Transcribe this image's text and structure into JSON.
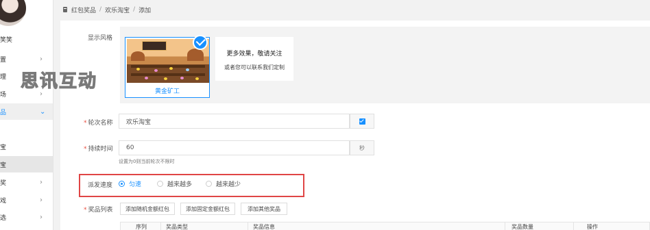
{
  "sidebar": {
    "username": "笑笑",
    "items": [
      {
        "label": "置",
        "chevron": "›"
      },
      {
        "label": "理",
        "chevron": ""
      },
      {
        "label": "场",
        "chevron": "›"
      },
      {
        "label": "品",
        "chevron": "⌄"
      },
      {
        "label": "宝",
        "chevron": ""
      },
      {
        "label": "宝",
        "chevron": ""
      },
      {
        "label": "奖",
        "chevron": "›"
      },
      {
        "label": "戏",
        "chevron": "›"
      },
      {
        "label": "选",
        "chevron": "›"
      }
    ]
  },
  "breadcrumb": [
    "红包奖品",
    "欢乐淘宝",
    "添加"
  ],
  "breadcrumb_separator": "/",
  "watermark": "思讯互动",
  "form": {
    "style_label": "显示风格",
    "theme_name": "黄金矿工",
    "more_title": "更多效果，敬请关注",
    "more_subtitle": "或者您可以联系我们定制",
    "round_name_label": "轮次名称",
    "round_name_value": "欢乐淘宝",
    "duration_label": "持续时间",
    "duration_value": "60",
    "duration_unit": "秒",
    "duration_hint": "设置为0则当前轮次不限时",
    "speed_label": "派发速度",
    "speed_options": [
      "匀速",
      "越来越多",
      "越来越少"
    ],
    "speed_selected": "匀速",
    "prize_label": "奖品列表",
    "prize_buttons": [
      "添加随机金额红包",
      "添加固定金额红包",
      "添加其他奖品"
    ],
    "table_headers": [
      "序列",
      "奖品类型",
      "奖品信息",
      "奖品数量",
      "操作"
    ]
  },
  "colors": {
    "accent": "#1890ff",
    "highlight": "#e04545",
    "required": "#e84c3d"
  }
}
